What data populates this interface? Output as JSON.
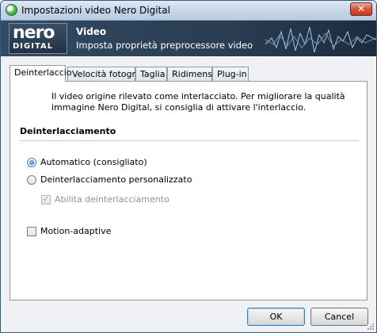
{
  "window": {
    "title": "Impostazioni video Nero Digital",
    "close_glyph": "✕"
  },
  "banner": {
    "logo_top": "nero",
    "logo_bottom": "DIGITAL",
    "title": "Video",
    "subtitle": "Imposta proprietà preprocessore video"
  },
  "tabs": [
    {
      "label": "Deinterlaccio",
      "active": true
    },
    {
      "label": "Velocità fotogr."
    },
    {
      "label": "Taglia"
    },
    {
      "label": "Ridimens."
    },
    {
      "label": "Plug-in"
    }
  ],
  "info": {
    "icon": "info-icon",
    "text": "Il video origine rilevato come interlacciato. Per migliorare la qualità immagine Nero Digital, si consiglia di attivare l'interlaccio."
  },
  "section": {
    "title": "Deinterlacciamento"
  },
  "options": {
    "automatic": {
      "label": "Automatico (consigliato)",
      "selected": true
    },
    "custom": {
      "label": "Deinterlacciamento personalizzato",
      "selected": false
    },
    "enable": {
      "label": "Abilita deinterlacciamento",
      "checked": true,
      "disabled": true
    },
    "motion": {
      "label": "Motion-adaptive",
      "checked": false
    }
  },
  "buttons": {
    "ok": "OK",
    "cancel": "Cancel"
  },
  "colors": {
    "banner": "#2a3d52",
    "accent": "#1e63b5",
    "close": "#c23b22"
  }
}
